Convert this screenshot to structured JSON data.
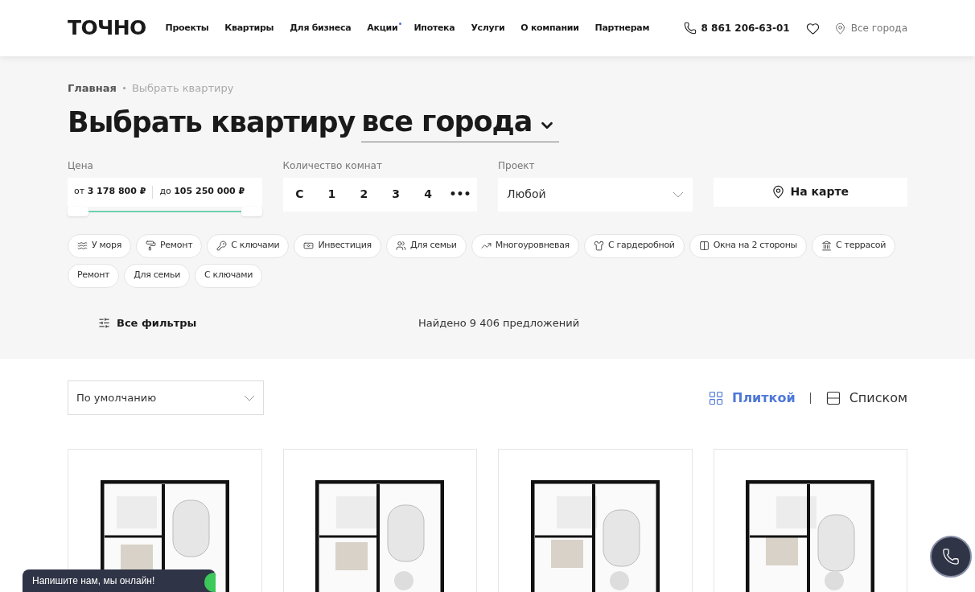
{
  "header": {
    "logo": "ТОЧНО",
    "nav": [
      {
        "label": "Проекты",
        "dot": false
      },
      {
        "label": "Квартиры",
        "dot": false
      },
      {
        "label": "Для бизнеса",
        "dot": false
      },
      {
        "label": "Акции",
        "dot": true
      },
      {
        "label": "Ипотека",
        "dot": false
      },
      {
        "label": "Услуги",
        "dot": false
      },
      {
        "label": "О компании",
        "dot": false
      },
      {
        "label": "Партнерам",
        "dot": false
      }
    ],
    "phone": "8 861 206-63-01",
    "city": "Все города"
  },
  "breadcrumbs": [
    "Главная",
    "Выбрать квартиру"
  ],
  "title": "Выбрать квартиру",
  "city_select": "все города",
  "filters": {
    "price": {
      "label": "Цена",
      "from_prefix": "от",
      "from": "3 178 800 ₽",
      "to_prefix": "до",
      "to": "105 250 000 ₽",
      "level": 1
    },
    "rooms": {
      "label": "Количество комнат",
      "options": [
        {
          "label": "С",
          "selected": false
        },
        {
          "label": "1",
          "selected": false
        },
        {
          "label": "2",
          "selected": false
        },
        {
          "label": "3",
          "selected": false
        },
        {
          "label": "4",
          "selected": false
        },
        {
          "label": "•••",
          "selected": false
        }
      ]
    },
    "project": {
      "label": "Проект",
      "value": "Любой"
    },
    "map_button": "На карте"
  },
  "tags": [
    "У моря",
    "Ремонт",
    "С ключами",
    "Инвестиция",
    "Для семьи",
    "Многоуровневая",
    "С гардеробной",
    "Окна на 2 стороны",
    "С террасой",
    "Ремонт",
    "Для семьи",
    "С ключами"
  ],
  "all_filters": "Все фильтры",
  "found": "Найдено 9 406 предложений",
  "sort": {
    "value": "По умолчанию"
  },
  "view": [
    {
      "label": "Плиткой",
      "kind": "grid",
      "selected": true
    },
    {
      "label": "Списком",
      "kind": "list",
      "selected": false
    }
  ],
  "chat": "Напишите нам, мы онлайн!"
}
